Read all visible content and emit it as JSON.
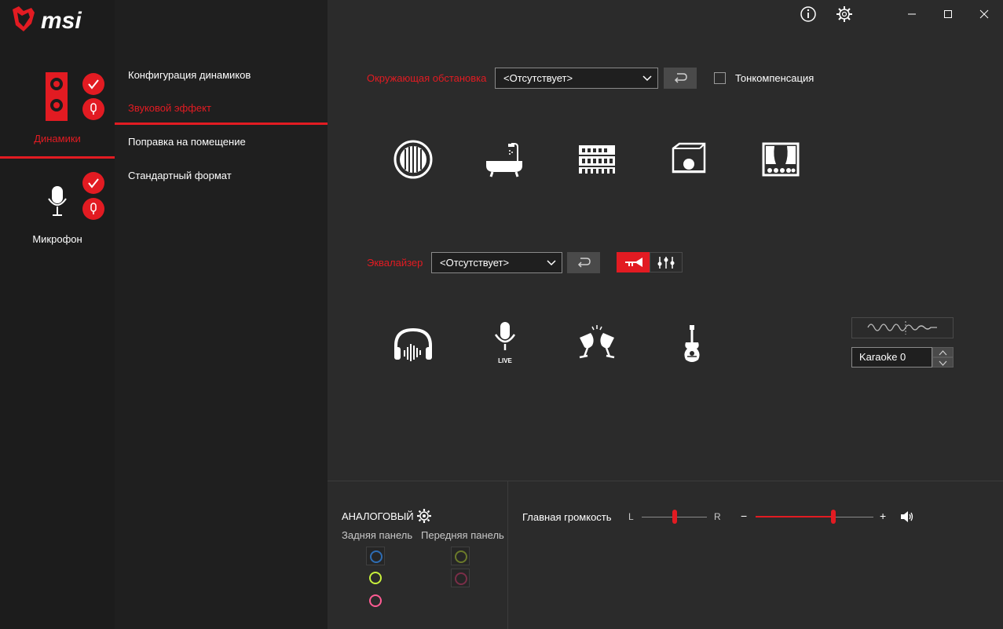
{
  "brand": "msi",
  "window": {
    "info_icon": "info-icon",
    "settings_icon": "gear-icon",
    "minimize_icon": "minimize-icon",
    "maximize_icon": "maximize-icon",
    "close_icon": "close-icon"
  },
  "devices": [
    {
      "label": "Динамики",
      "active": true,
      "icon": "speaker-icon"
    },
    {
      "label": "Микрофон",
      "active": false,
      "icon": "microphone-icon"
    }
  ],
  "submenu": [
    {
      "label": "Конфигурация динамиков",
      "active": false
    },
    {
      "label": "Звуковой эффект",
      "active": true
    },
    {
      "label": "Поправка на помещение",
      "active": false
    },
    {
      "label": "Стандартный формат",
      "active": false
    }
  ],
  "environment": {
    "label": "Окружающая обстановка",
    "selected": "<Отсутствует>",
    "loudness_label": "Тонкомпенсация",
    "loudness_checked": false,
    "presets": [
      "padded-cell-icon",
      "bathroom-icon",
      "colosseum-icon",
      "room-icon",
      "theater-icon"
    ]
  },
  "equalizer": {
    "label": "Эквалайзер",
    "selected": "<Отсутствует>",
    "presets": [
      "headphones-icon",
      "live-mic-icon",
      "party-icon",
      "guitar-icon"
    ],
    "live_text": "LIVE",
    "karaoke_value": "Karaoke 0"
  },
  "bottom": {
    "analog_label": "АНАЛОГОВЫЙ",
    "rear_label": "Задняя панель",
    "front_label": "Передняя панель",
    "rear_jacks": [
      "#2e6db4",
      "#c8f03c",
      "#ff5b93"
    ],
    "front_jacks": [
      "#6b7a2a",
      "#7a2e48"
    ],
    "volume_label": "Главная громкость",
    "balance_left": "L",
    "balance_right": "R",
    "balance_value": 0.5,
    "volume_minus": "−",
    "volume_plus": "+",
    "volume_value": 0.66
  },
  "colors": {
    "accent": "#e21b22"
  }
}
